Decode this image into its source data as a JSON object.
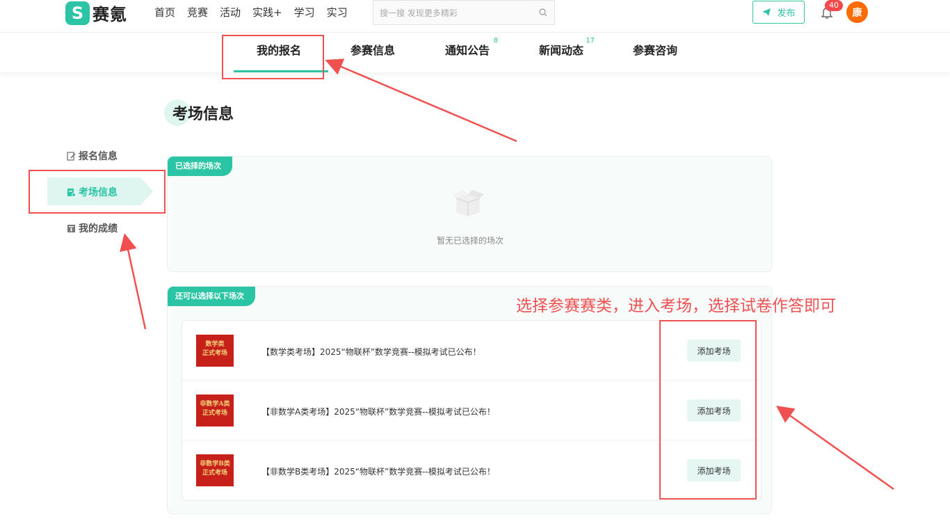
{
  "header": {
    "logo_mark": "S",
    "logo_text": "赛氪",
    "nav": [
      "首页",
      "竞赛",
      "活动",
      "实践+",
      "学习",
      "实习"
    ],
    "search_placeholder": "搜一搜 发现更多精彩",
    "publish_label": "发布",
    "notification_count": "40",
    "avatar_char": "康"
  },
  "subnav": {
    "tabs": [
      {
        "label": "我的报名",
        "count": ""
      },
      {
        "label": "参赛信息",
        "count": ""
      },
      {
        "label": "通知公告",
        "count": "8"
      },
      {
        "label": "新闻动态",
        "count": "17"
      },
      {
        "label": "参赛咨询",
        "count": ""
      }
    ],
    "active_index": 0
  },
  "page": {
    "title": "考场信息"
  },
  "sidebar": {
    "items": [
      {
        "label": "报名信息",
        "icon": "edit-icon"
      },
      {
        "label": "考场信息",
        "icon": "exam-icon"
      },
      {
        "label": "我的成绩",
        "icon": "score-icon"
      }
    ],
    "active_index": 1
  },
  "selected_panel": {
    "tag": "已选择的场次",
    "empty_text": "暂无已选择的场次"
  },
  "available_panel": {
    "tag": "还可以选择以下场次",
    "rows": [
      {
        "thumb_line1": "数学类",
        "thumb_line2": "正式考场",
        "title": "【数学类考场】2025“物联杯”数学竞赛--模拟考试已公布！",
        "button": "添加考场"
      },
      {
        "thumb_line1": "非数学A类",
        "thumb_line2": "正式考场",
        "title": "【非数学A类考场】2025“物联杯”数学竞赛--模拟考试已公布！",
        "button": "添加考场"
      },
      {
        "thumb_line1": "非数学B类",
        "thumb_line2": "正式考场",
        "title": "【非数学B类考场】2025“物联杯”数学竞赛--模拟考试已公布！",
        "button": "添加考场"
      }
    ]
  },
  "annotation": {
    "text": "选择参赛赛类，进入考场，选择试卷作答即可",
    "color": "#f05050"
  },
  "colors": {
    "accent": "#2bc4a4",
    "badge": "#f5484a",
    "avatar": "#ff6b00"
  }
}
